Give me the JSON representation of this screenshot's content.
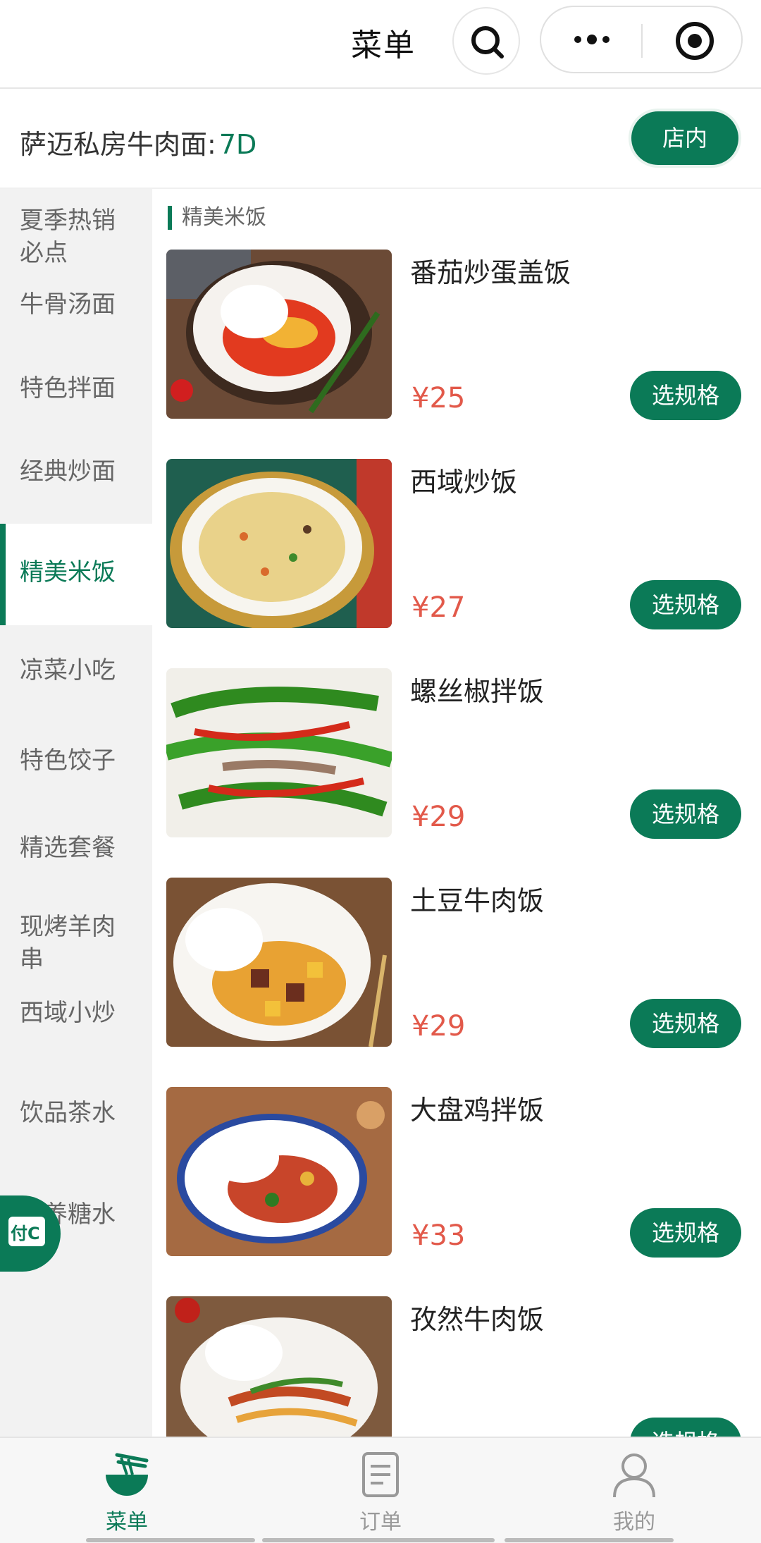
{
  "topbar": {
    "title": "菜单"
  },
  "store": {
    "label": "萨迈私房牛肉面:",
    "code": "7D",
    "dine_button": "店内"
  },
  "sidebar": {
    "items": [
      {
        "label": "夏季热销必点"
      },
      {
        "label": "牛骨汤面"
      },
      {
        "label": "特色拌面"
      },
      {
        "label": "经典炒面"
      },
      {
        "label": "精美米饭"
      },
      {
        "label": "凉菜小吃"
      },
      {
        "label": "特色饺子"
      },
      {
        "label": "精选套餐"
      },
      {
        "label": "现烤羊肉串"
      },
      {
        "label": "西域小炒"
      },
      {
        "label": "饮品茶水"
      },
      {
        "label": "营养糖水"
      }
    ],
    "active": "精美米饭"
  },
  "float_button": {
    "label": "付C"
  },
  "content": {
    "section_title": "精美米饭",
    "items": [
      {
        "name": "番茄炒蛋盖饭",
        "price": "¥25",
        "button": "选规格"
      },
      {
        "name": "西域炒饭",
        "price": "¥27",
        "button": "选规格"
      },
      {
        "name": "螺丝椒拌饭",
        "price": "¥29",
        "button": "选规格"
      },
      {
        "name": "土豆牛肉饭",
        "price": "¥29",
        "button": "选规格"
      },
      {
        "name": "大盘鸡拌饭",
        "price": "¥33",
        "button": "选规格"
      },
      {
        "name": "孜然牛肉饭",
        "price": "",
        "button": "选规格"
      }
    ]
  },
  "tabbar": {
    "tabs": [
      {
        "label": "菜单",
        "icon": "noodle-bowl-icon"
      },
      {
        "label": "订单",
        "icon": "document-icon"
      },
      {
        "label": "我的",
        "icon": "user-icon"
      }
    ]
  },
  "colors": {
    "brand": "#0b7a57",
    "price": "#e2594a"
  }
}
